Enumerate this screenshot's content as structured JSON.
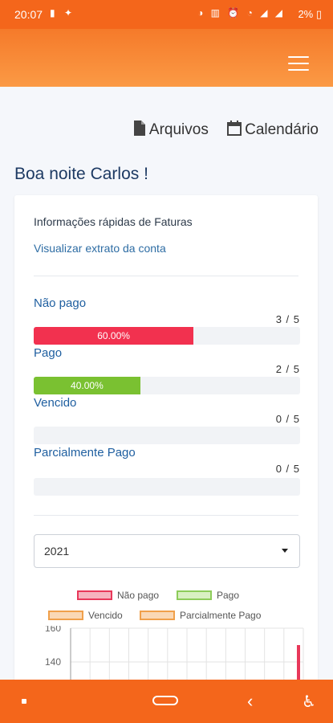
{
  "status": {
    "time": "20:07",
    "left_icons": "▮ ✦",
    "right_icons": "◑ ▥ ⏰ ◔ ◢ ◢",
    "battery": "2% ▯"
  },
  "header": {
    "menu_icon": "hamburger-icon"
  },
  "toplinks": {
    "files_label": "Arquivos",
    "calendar_label": "Calendário"
  },
  "greeting": "Boa noite Carlos !",
  "card": {
    "title": "Informações rápidas de Faturas",
    "link": "Visualizar extrato da conta",
    "stats": [
      {
        "label": "Não pago",
        "count": "3 / 5",
        "percent": 60,
        "percent_label": "60.00%",
        "color": "#f2314f"
      },
      {
        "label": "Pago",
        "count": "2 / 5",
        "percent": 40,
        "percent_label": "40.00%",
        "color": "#7ac131"
      },
      {
        "label": "Vencido",
        "count": "0 / 5",
        "percent": 0,
        "percent_label": "",
        "color": "#f0a04b"
      },
      {
        "label": "Parcialmente Pago",
        "count": "0 / 5",
        "percent": 0,
        "percent_label": "",
        "color": "#f0a04b"
      }
    ],
    "year_select": {
      "value": "2021"
    }
  },
  "chart_data": {
    "type": "bar",
    "legend": [
      {
        "name": "Não pago",
        "fill": "#f6b3bf",
        "stroke": "#e8385a"
      },
      {
        "name": "Pago",
        "fill": "#d9f0c2",
        "stroke": "#8dcc5a"
      },
      {
        "name": "Vencido",
        "fill": "#fad8b5",
        "stroke": "#f0a04b"
      },
      {
        "name": "Parcialmente Pago",
        "fill": "#fad8b5",
        "stroke": "#f0a04b"
      }
    ],
    "y_ticks": [
      "160",
      "140"
    ],
    "ylim": [
      140,
      160
    ],
    "series": [
      {
        "name": "Não pago",
        "values": [
          0,
          0,
          0,
          0,
          0,
          0,
          0,
          0,
          0,
          0,
          0,
          150
        ]
      }
    ],
    "grid": true
  },
  "nav": {
    "back_icon": "back-icon",
    "home_icon": "home-icon",
    "accessibility_icon": "accessibility-icon"
  }
}
